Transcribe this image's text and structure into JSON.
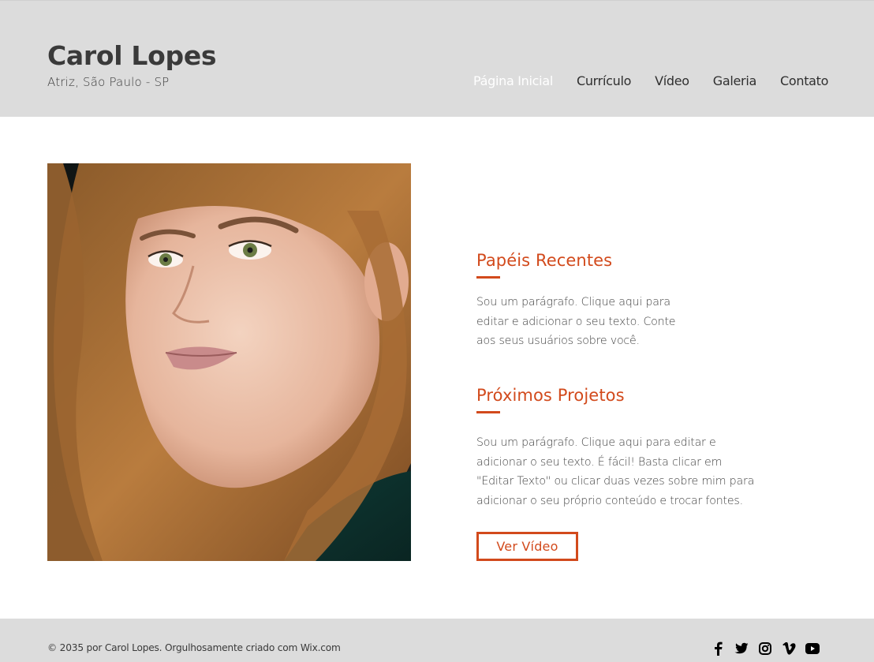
{
  "header": {
    "title": "Carol Lopes",
    "subtitle": "Atriz, São Paulo - SP"
  },
  "nav": {
    "items": [
      {
        "label": "Página Inicial",
        "active": true
      },
      {
        "label": "Currículo"
      },
      {
        "label": "Vídeo"
      },
      {
        "label": "Galeria"
      },
      {
        "label": "Contato"
      }
    ]
  },
  "main": {
    "portrait_icon": "portrait-photo",
    "sections": [
      {
        "title": "Papéis Recentes",
        "lines": [
          "Sou um parágrafo. Clique aqui para",
          "editar e adicionar o seu texto. Conte",
          "aos seus usuários sobre você."
        ]
      },
      {
        "title": "Próximos Projetos",
        "lines": [
          "Sou um parágrafo. Clique aqui para editar e",
          "adicionar o seu texto. É fácil! Basta clicar em",
          "\"Editar Texto\" ou clicar duas vezes sobre mim para",
          "adicionar o seu próprio conteúdo e trocar fontes."
        ]
      }
    ],
    "button_label": "Ver Vídeo"
  },
  "footer": {
    "copyright": "© 2035 por Carol Lopes. Orgulhosamente criado com Wix.com",
    "social_icons": [
      "facebook-icon",
      "twitter-icon",
      "instagram-icon",
      "vimeo-icon",
      "youtube-icon"
    ]
  },
  "colors": {
    "accent": "#d24a1c",
    "header_bg": "#dcdcdc",
    "footer_bg": "#dcdcdc",
    "text": "#333333"
  }
}
